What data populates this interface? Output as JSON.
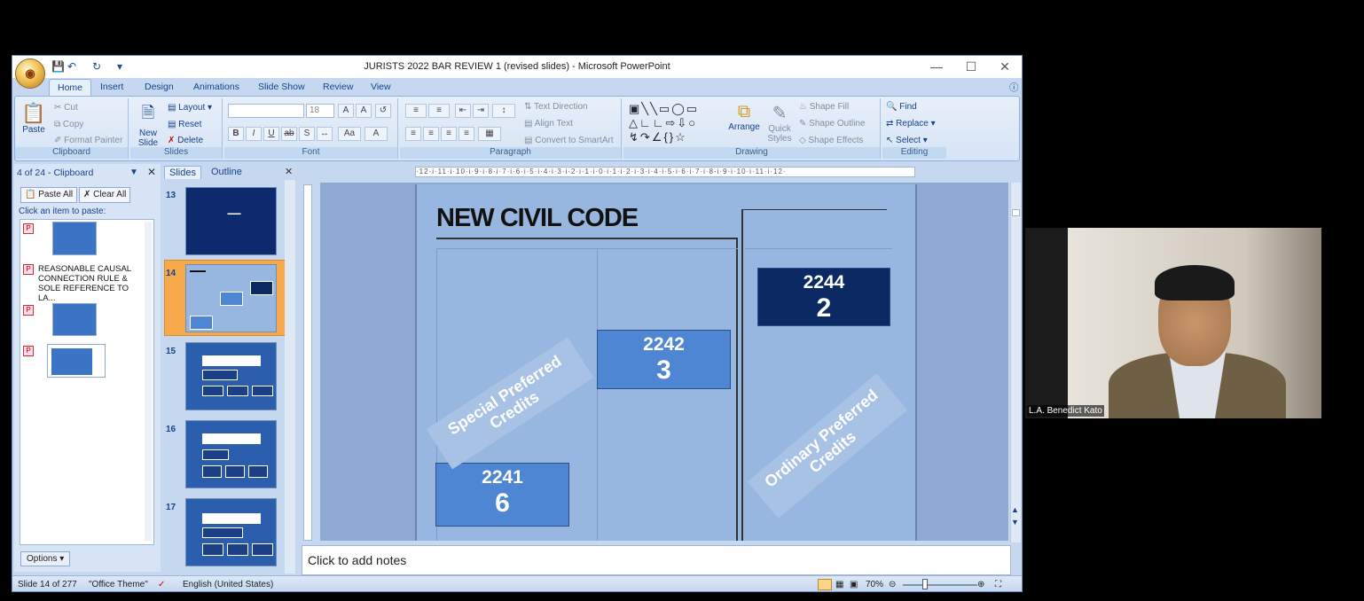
{
  "window": {
    "title": "JURISTS 2022 BAR REVIEW 1 (revised slides) - Microsoft PowerPoint"
  },
  "tabs": [
    "Home",
    "Insert",
    "Design",
    "Animations",
    "Slide Show",
    "Review",
    "View"
  ],
  "ribbon": {
    "clipboard": {
      "paste": "Paste",
      "cut": "Cut",
      "copy": "Copy",
      "format_painter": "Format Painter",
      "label": "Clipboard"
    },
    "slides": {
      "new_slide": "New Slide",
      "layout": "Layout",
      "reset": "Reset",
      "delete": "Delete",
      "label": "Slides"
    },
    "font": {
      "size": "18",
      "label": "Font"
    },
    "paragraph": {
      "text_direction": "Text Direction",
      "align_text": "Align Text",
      "convert": "Convert to SmartArt",
      "label": "Paragraph"
    },
    "drawing": {
      "arrange": "Arrange",
      "quick_styles": "Quick Styles",
      "shape_fill": "Shape Fill",
      "shape_outline": "Shape Outline",
      "shape_effects": "Shape Effects",
      "label": "Drawing"
    },
    "editing": {
      "find": "Find",
      "replace": "Replace",
      "select": "Select",
      "label": "Editing"
    }
  },
  "clipboard_pane": {
    "header": "4 of 24 - Clipboard",
    "paste_all": "Paste All",
    "clear_all": "Clear All",
    "hint": "Click an item to paste:",
    "text_item": "REASONABLE CAUSAL CONNECTION RULE & SOLE REFERENCE TO LA...",
    "options": "Options"
  },
  "slides_pane": {
    "tabs": [
      "Slides",
      "Outline"
    ],
    "slide_numbers": [
      "13",
      "14",
      "15",
      "16",
      "17"
    ]
  },
  "slide": {
    "title": "NEW CIVIL CODE",
    "box_2244": {
      "article": "2244",
      "count": "2"
    },
    "box_2242": {
      "article": "2242",
      "count": "3"
    },
    "box_2241": {
      "article": "2241",
      "count": "6"
    },
    "arrow_special": "Special Preferred Credits",
    "arrow_ordinary": "Ordinary Preferred Credits"
  },
  "ruler": "·12·i·11·i·10·i·9·i·8·i·7·i·6·i·5·i·4·i·3·i·2·i·1·i·0·i·1·i·2·i·3·i·4·i·5·i·6·i·7·i·8·i·9·i·10·i·11·i·12·",
  "notes_placeholder": "Click to add notes",
  "status": {
    "slide": "Slide 14 of 277",
    "theme": "\"Office Theme\"",
    "language": "English (United States)",
    "zoom": "70%"
  },
  "webcam": {
    "name": "L.A. Benedict Kato"
  },
  "colors": {
    "box_dark": "#0b2a63",
    "box_medium": "#4f86d3",
    "slide_bg": "#97b7e0",
    "accent": "#15428b"
  }
}
